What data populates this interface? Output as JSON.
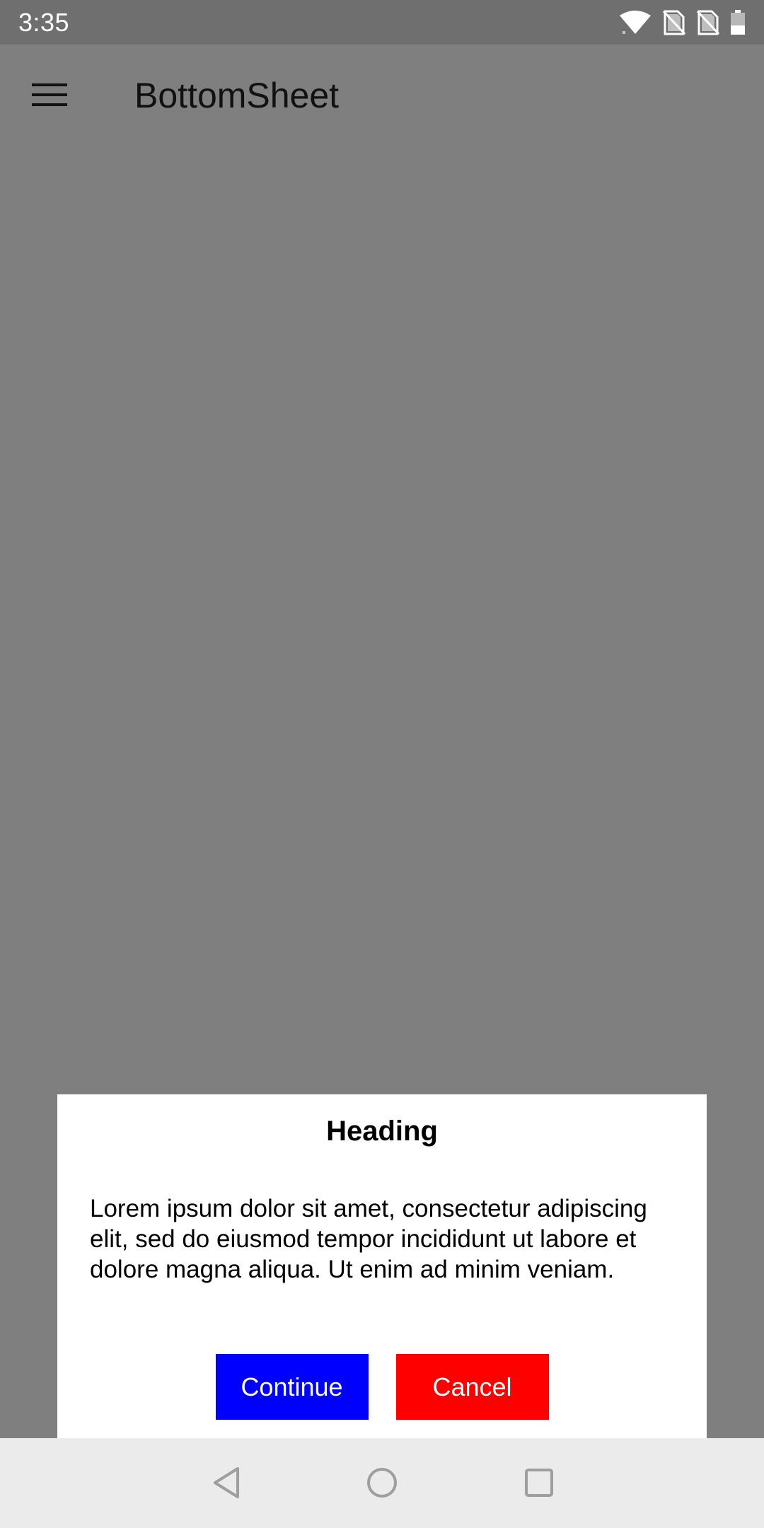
{
  "status_bar": {
    "time": "3:35",
    "icons": [
      "wifi-icon",
      "no-sim-icon",
      "no-sim-icon",
      "battery-icon"
    ]
  },
  "app_bar": {
    "title": "BottomSheet",
    "menu_icon": "menu-icon"
  },
  "bottom_sheet": {
    "heading": "Heading",
    "body": "Lorem ipsum dolor sit amet, consectetur adipiscing elit, sed do eiusmod tempor incididunt ut labore et dolore magna aliqua. Ut enim ad minim veniam.",
    "continue_label": "Continue",
    "cancel_label": "Cancel"
  },
  "nav_bar": {
    "icons": [
      "back-icon",
      "home-icon",
      "recents-icon"
    ]
  },
  "colors": {
    "status_bar": "#6f6f6f",
    "scrim": "#7f7f7f",
    "continue_button": "#0000ff",
    "cancel_button": "#ff0000",
    "nav_bar": "#ebebeb"
  }
}
